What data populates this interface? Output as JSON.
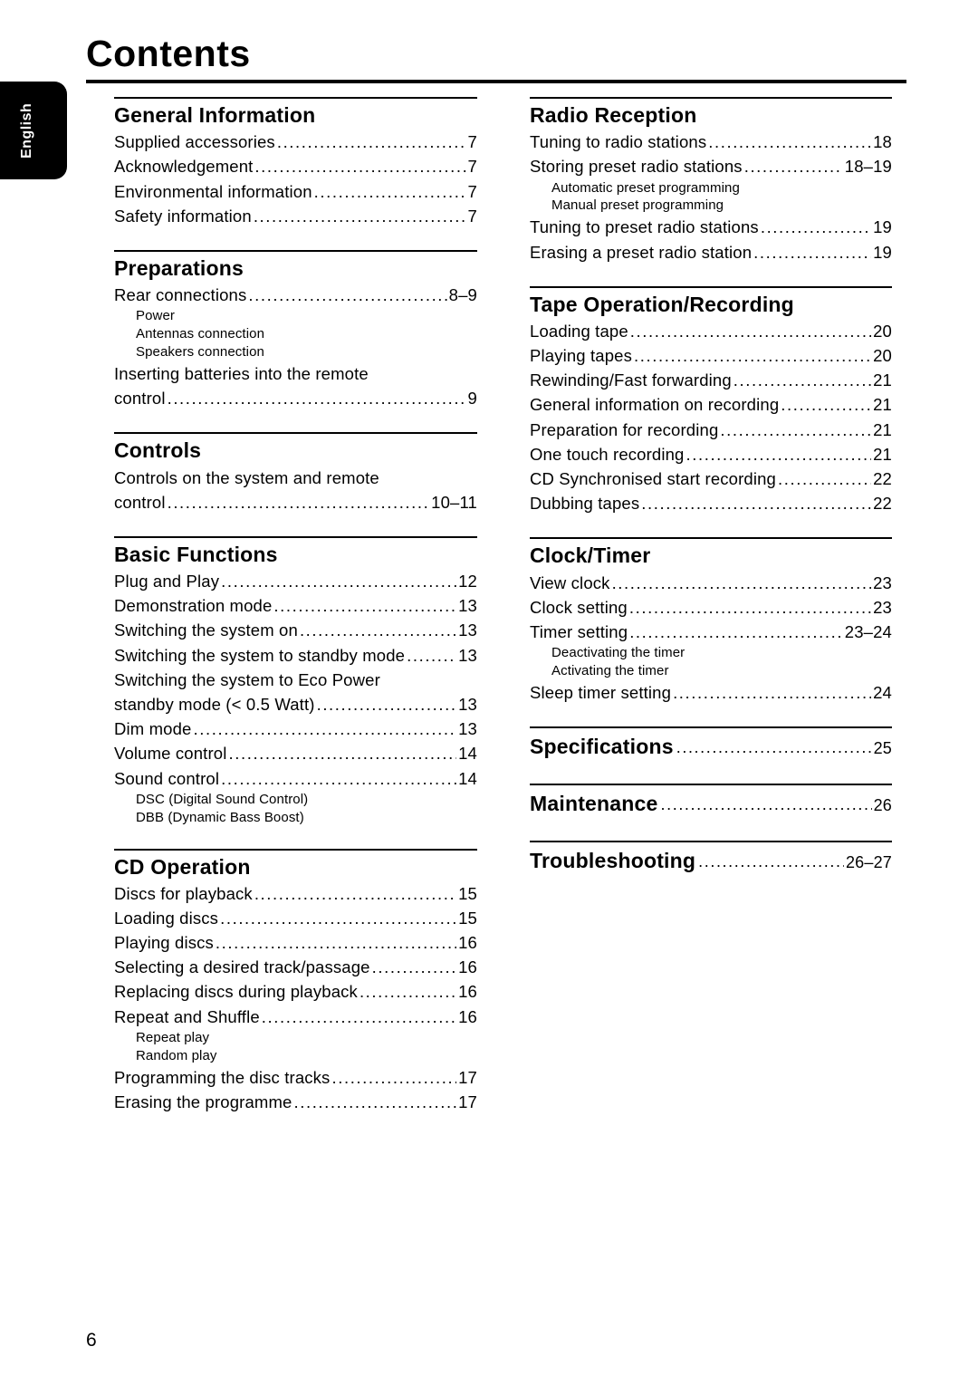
{
  "page": {
    "title": "Contents",
    "folio": "6",
    "language_tab": "English"
  },
  "leader": "........................................................................................................",
  "columns": {
    "left": [
      {
        "id": "general-information",
        "title": "General Information",
        "entries": [
          {
            "text": "Supplied accessories",
            "page": "7"
          },
          {
            "text": "Acknowledgement",
            "page": "7"
          },
          {
            "text": "Environmental information",
            "page": "7"
          },
          {
            "text": "Safety information",
            "page": "7"
          }
        ]
      },
      {
        "id": "preparations",
        "title": "Preparations",
        "entries": [
          {
            "text": "Rear connections",
            "page": "8–9"
          },
          {
            "sub": "Power"
          },
          {
            "sub": "Antennas connection"
          },
          {
            "sub": "Speakers connection"
          },
          {
            "plain": "Inserting batteries into the remote"
          },
          {
            "text": "control",
            "page": "9"
          }
        ]
      },
      {
        "id": "controls",
        "title": "Controls",
        "entries": [
          {
            "plain": "Controls on the system and remote"
          },
          {
            "text": "control",
            "page": "10–11"
          }
        ]
      },
      {
        "id": "basic-functions",
        "title": "Basic Functions",
        "entries": [
          {
            "text": "Plug and Play",
            "page": "12"
          },
          {
            "text": "Demonstration mode",
            "page": "13"
          },
          {
            "text": "Switching the system on",
            "page": "13"
          },
          {
            "text": "Switching the system to standby mode",
            "page": "13"
          },
          {
            "plain": "Switching the system to Eco Power"
          },
          {
            "text": "standby mode (< 0.5 Watt)",
            "page": "13"
          },
          {
            "text": "Dim mode",
            "page": "13"
          },
          {
            "text": "Volume control",
            "page": "14"
          },
          {
            "text": "Sound control",
            "page": "14"
          },
          {
            "sub": "DSC (Digital Sound Control)"
          },
          {
            "sub": "DBB (Dynamic Bass Boost)"
          }
        ]
      },
      {
        "id": "cd-operation",
        "title": "CD Operation",
        "entries": [
          {
            "text": "Discs for playback",
            "page": "15"
          },
          {
            "text": "Loading discs",
            "page": "15"
          },
          {
            "text": "Playing discs",
            "page": "16"
          },
          {
            "text": "Selecting a desired track/passage",
            "page": "16"
          },
          {
            "text": "Replacing discs during playback",
            "page": "16"
          },
          {
            "text": "Repeat and Shuffle",
            "page": "16"
          },
          {
            "sub": "Repeat play"
          },
          {
            "sub": "Random play"
          },
          {
            "text": "Programming the disc tracks",
            "page": "17"
          },
          {
            "text": "Erasing the programme",
            "page": "17"
          }
        ]
      }
    ],
    "right": [
      {
        "id": "radio-reception",
        "title": "Radio Reception",
        "entries": [
          {
            "text": "Tuning to radio stations",
            "page": "18"
          },
          {
            "text": "Storing preset radio stations",
            "page": "18–19"
          },
          {
            "sub": "Automatic preset programming"
          },
          {
            "sub": "Manual preset programming"
          },
          {
            "text": "Tuning to preset radio stations",
            "page": "19"
          },
          {
            "text": "Erasing a preset radio station",
            "page": "19"
          }
        ]
      },
      {
        "id": "tape-operation-recording",
        "title": "Tape Operation/Recording",
        "entries": [
          {
            "text": "Loading tape",
            "page": "20"
          },
          {
            "text": "Playing tapes",
            "page": "20"
          },
          {
            "text": "Rewinding/Fast forwarding",
            "page": "21"
          },
          {
            "text": "General information on recording",
            "page": "21"
          },
          {
            "text": "Preparation for recording",
            "page": "21"
          },
          {
            "text": "One touch recording",
            "page": "21"
          },
          {
            "text": "CD Synchronised start recording",
            "page": "22"
          },
          {
            "text": "Dubbing tapes",
            "page": "22"
          }
        ]
      },
      {
        "id": "clock-timer",
        "title": "Clock/Timer",
        "entries": [
          {
            "text": "View clock",
            "page": "23"
          },
          {
            "text": "Clock setting",
            "page": "23"
          },
          {
            "text": "Timer setting",
            "page": "23–24"
          },
          {
            "sub": "Deactivating the timer"
          },
          {
            "sub": "Activating the timer"
          },
          {
            "text": "Sleep timer setting",
            "page": "24"
          }
        ]
      },
      {
        "id": "specifications",
        "title": "Specifications",
        "inline": true,
        "page": "25",
        "entries": []
      },
      {
        "id": "maintenance",
        "title": "Maintenance",
        "inline": true,
        "page": "26",
        "entries": []
      },
      {
        "id": "troubleshooting",
        "title": "Troubleshooting",
        "inline": true,
        "page": "26–27",
        "entries": []
      }
    ]
  }
}
